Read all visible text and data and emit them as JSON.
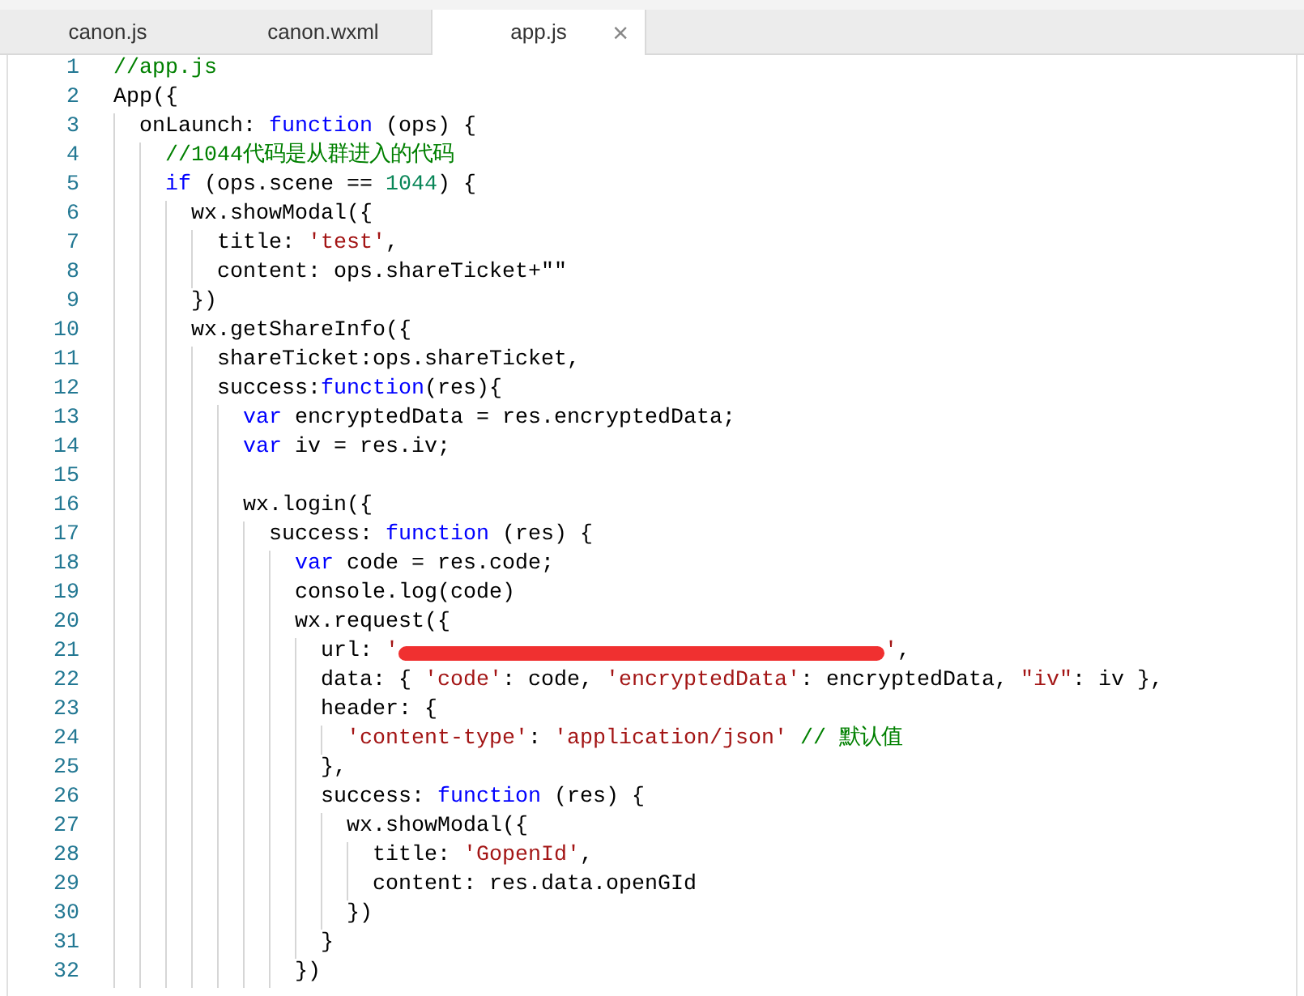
{
  "tabs": [
    {
      "label": "canon.js",
      "selected": false
    },
    {
      "label": "canon.wxml",
      "selected": false
    },
    {
      "label": "app.js",
      "selected": true,
      "close": "×"
    }
  ],
  "editor": {
    "lines": [
      {
        "number": "1",
        "tokens": [
          {
            "kind": "comment",
            "text": "//app.js"
          }
        ]
      },
      {
        "number": "2",
        "tokens": [
          {
            "kind": "plain",
            "text": "App({"
          }
        ]
      },
      {
        "number": "3",
        "tokens": [
          {
            "kind": "plain",
            "text": "  onLaunch: "
          },
          {
            "kind": "keyword",
            "text": "function"
          },
          {
            "kind": "plain",
            "text": " (ops) {"
          }
        ]
      },
      {
        "number": "4",
        "tokens": [
          {
            "kind": "comment",
            "text": "    //1044代码是从群进入的代码"
          }
        ]
      },
      {
        "number": "5",
        "tokens": [
          {
            "kind": "keyword",
            "text": "    if"
          },
          {
            "kind": "plain",
            "text": " (ops.scene == "
          },
          {
            "kind": "number",
            "text": "1044"
          },
          {
            "kind": "plain",
            "text": ") {"
          }
        ]
      },
      {
        "number": "6",
        "tokens": [
          {
            "kind": "plain",
            "text": "      wx.showModal({"
          }
        ]
      },
      {
        "number": "7",
        "tokens": [
          {
            "kind": "plain",
            "text": "        title: "
          },
          {
            "kind": "string",
            "text": "'test'"
          },
          {
            "kind": "plain",
            "text": ","
          }
        ]
      },
      {
        "number": "8",
        "tokens": [
          {
            "kind": "plain",
            "text": "        content: ops.shareTicket+\"\""
          }
        ]
      },
      {
        "number": "9",
        "tokens": [
          {
            "kind": "plain",
            "text": "      })"
          }
        ]
      },
      {
        "number": "10",
        "tokens": [
          {
            "kind": "plain",
            "text": "      wx.getShareInfo({"
          }
        ]
      },
      {
        "number": "11",
        "tokens": [
          {
            "kind": "plain",
            "text": "        shareTicket:ops.shareTicket,"
          }
        ]
      },
      {
        "number": "12",
        "tokens": [
          {
            "kind": "plain",
            "text": "        success:"
          },
          {
            "kind": "keyword",
            "text": "function"
          },
          {
            "kind": "plain",
            "text": "(res){"
          }
        ]
      },
      {
        "number": "13",
        "tokens": [
          {
            "kind": "keyword",
            "text": "          var"
          },
          {
            "kind": "plain",
            "text": " encryptedData = res.encryptedData;"
          }
        ]
      },
      {
        "number": "14",
        "tokens": [
          {
            "kind": "keyword",
            "text": "          var"
          },
          {
            "kind": "plain",
            "text": " iv = res.iv;"
          }
        ]
      },
      {
        "number": "15"
      },
      {
        "number": "16",
        "tokens": [
          {
            "kind": "plain",
            "text": "          wx.login({"
          }
        ]
      },
      {
        "number": "17",
        "tokens": [
          {
            "kind": "plain",
            "text": "            success: "
          },
          {
            "kind": "keyword",
            "text": "function"
          },
          {
            "kind": "plain",
            "text": " (res) {"
          }
        ]
      },
      {
        "number": "18",
        "tokens": [
          {
            "kind": "keyword",
            "text": "              var"
          },
          {
            "kind": "plain",
            "text": " code = res.code;"
          }
        ]
      },
      {
        "number": "19",
        "tokens": [
          {
            "kind": "plain",
            "text": "              console.log(code)"
          }
        ]
      },
      {
        "number": "20",
        "tokens": [
          {
            "kind": "plain",
            "text": "              wx.request({"
          }
        ]
      },
      {
        "number": "21",
        "tokens": [
          {
            "kind": "plain",
            "text": "                url: "
          },
          {
            "kind": "string",
            "text": "'"
          },
          {
            "kind": "redaction"
          },
          {
            "kind": "string",
            "text": "'"
          },
          {
            "kind": "plain",
            "text": ","
          }
        ]
      },
      {
        "number": "22",
        "tokens": [
          {
            "kind": "plain",
            "text": "                data: { "
          },
          {
            "kind": "string",
            "text": "'code'"
          },
          {
            "kind": "plain",
            "text": ": code, "
          },
          {
            "kind": "string",
            "text": "'encryptedData'"
          },
          {
            "kind": "plain",
            "text": ": encryptedData, "
          },
          {
            "kind": "string",
            "text": "\"iv\""
          },
          {
            "kind": "plain",
            "text": ": iv },"
          }
        ]
      },
      {
        "number": "23",
        "tokens": [
          {
            "kind": "plain",
            "text": "                header: {"
          }
        ]
      },
      {
        "number": "24",
        "tokens": [
          {
            "kind": "string",
            "text": "                  'content-type'"
          },
          {
            "kind": "plain",
            "text": ": "
          },
          {
            "kind": "string",
            "text": "'application/json'"
          },
          {
            "kind": "comment",
            "text": " // 默认值"
          }
        ]
      },
      {
        "number": "25",
        "tokens": [
          {
            "kind": "plain",
            "text": "                },"
          }
        ]
      },
      {
        "number": "26",
        "tokens": [
          {
            "kind": "plain",
            "text": "                success: "
          },
          {
            "kind": "keyword",
            "text": "function"
          },
          {
            "kind": "plain",
            "text": " (res) {"
          }
        ]
      },
      {
        "number": "27",
        "tokens": [
          {
            "kind": "plain",
            "text": "                  wx.showModal({"
          }
        ]
      },
      {
        "number": "28",
        "tokens": [
          {
            "kind": "plain",
            "text": "                    title: "
          },
          {
            "kind": "string",
            "text": "'GopenId'"
          },
          {
            "kind": "plain",
            "text": ","
          }
        ]
      },
      {
        "number": "29",
        "tokens": [
          {
            "kind": "plain",
            "text": "                    content: res.data.openGId"
          }
        ]
      },
      {
        "number": "30",
        "tokens": [
          {
            "kind": "plain",
            "text": "                  })"
          }
        ]
      },
      {
        "number": "31",
        "tokens": [
          {
            "kind": "plain",
            "text": "                }"
          }
        ]
      },
      {
        "number": "32",
        "tokens": [
          {
            "kind": "plain",
            "text": "              })"
          }
        ]
      }
    ]
  }
}
